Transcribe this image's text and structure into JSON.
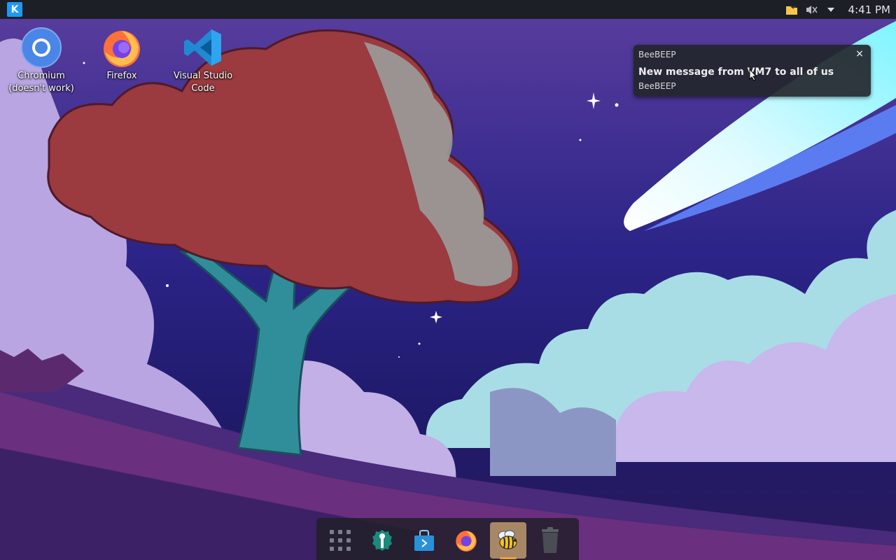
{
  "top_panel": {
    "launcher_icon": "kde-icon",
    "tray_icons": [
      "folder-icon",
      "volume-muted-icon",
      "expand-tray-arrow-icon"
    ],
    "clock": "4:41 PM"
  },
  "desktop_icons": [
    {
      "label": "Chromium (doesn't work)",
      "icon": "chromium-icon"
    },
    {
      "label": "Firefox",
      "icon": "firefox-icon"
    },
    {
      "label": "Visual Studio Code",
      "icon": "vscode-icon"
    }
  ],
  "notification": {
    "app_name": "BeeBEEP",
    "title": "New message from VM7 to all of us",
    "body": "BeeBEEP",
    "close_glyph": "×"
  },
  "dock": {
    "items": [
      {
        "icon": "app-grid-icon"
      },
      {
        "icon": "settings-wrench-icon"
      },
      {
        "icon": "store-bag-icon"
      },
      {
        "icon": "firefox-icon"
      },
      {
        "icon": "beebeep-bee-icon",
        "active": true
      },
      {
        "icon": "trash-icon"
      }
    ]
  },
  "colors": {
    "panel": "#1c1f26",
    "accent": "#1d99f3",
    "sky_dark": "#231b6b",
    "cloud": "#c9b3e6",
    "tree_foliage": "#9b3a3f"
  }
}
